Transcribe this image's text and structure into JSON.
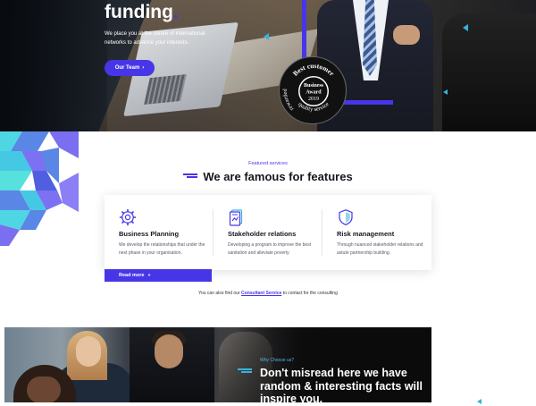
{
  "hero": {
    "title": "funding",
    "title_dot": ".",
    "lead": "We place you at the centre of international networks to advance your interests.",
    "cta_label": "Our Team",
    "cta_arrow": "›",
    "badge": {
      "ring_top": "Best customer",
      "ring_bottom": "quality service",
      "ring_left": "rewarded",
      "center_line1": "Business",
      "center_line2": "Award",
      "center_year": "2019"
    }
  },
  "features": {
    "eyebrow": "Featured services",
    "title": "We are famous for features",
    "cards": [
      {
        "icon": "gear-icon",
        "title": "Business Planning",
        "text": "We develop the relationships that under the next phase in your organisation."
      },
      {
        "icon": "document-icon",
        "title": "Stakeholder relations",
        "text": "Developing a program to improve the best sanitation and alleviate poverty"
      },
      {
        "icon": "shield-icon",
        "title": "Risk management",
        "text": "Through nuanced stakeholder relations and astute partnership building."
      }
    ],
    "read_more": "Read more",
    "read_more_icon": "»",
    "consult_prefix": "You can also find our",
    "consult_link": "Consultant Service",
    "consult_suffix": "to contact for the consulting"
  },
  "why": {
    "eyebrow": "Why Choose us?",
    "title": "Don't misread here we have random & interesting facts will inspire you."
  },
  "colors": {
    "accent": "#4736e8",
    "cyan": "#36b3dc",
    "dark": "#16171f"
  }
}
